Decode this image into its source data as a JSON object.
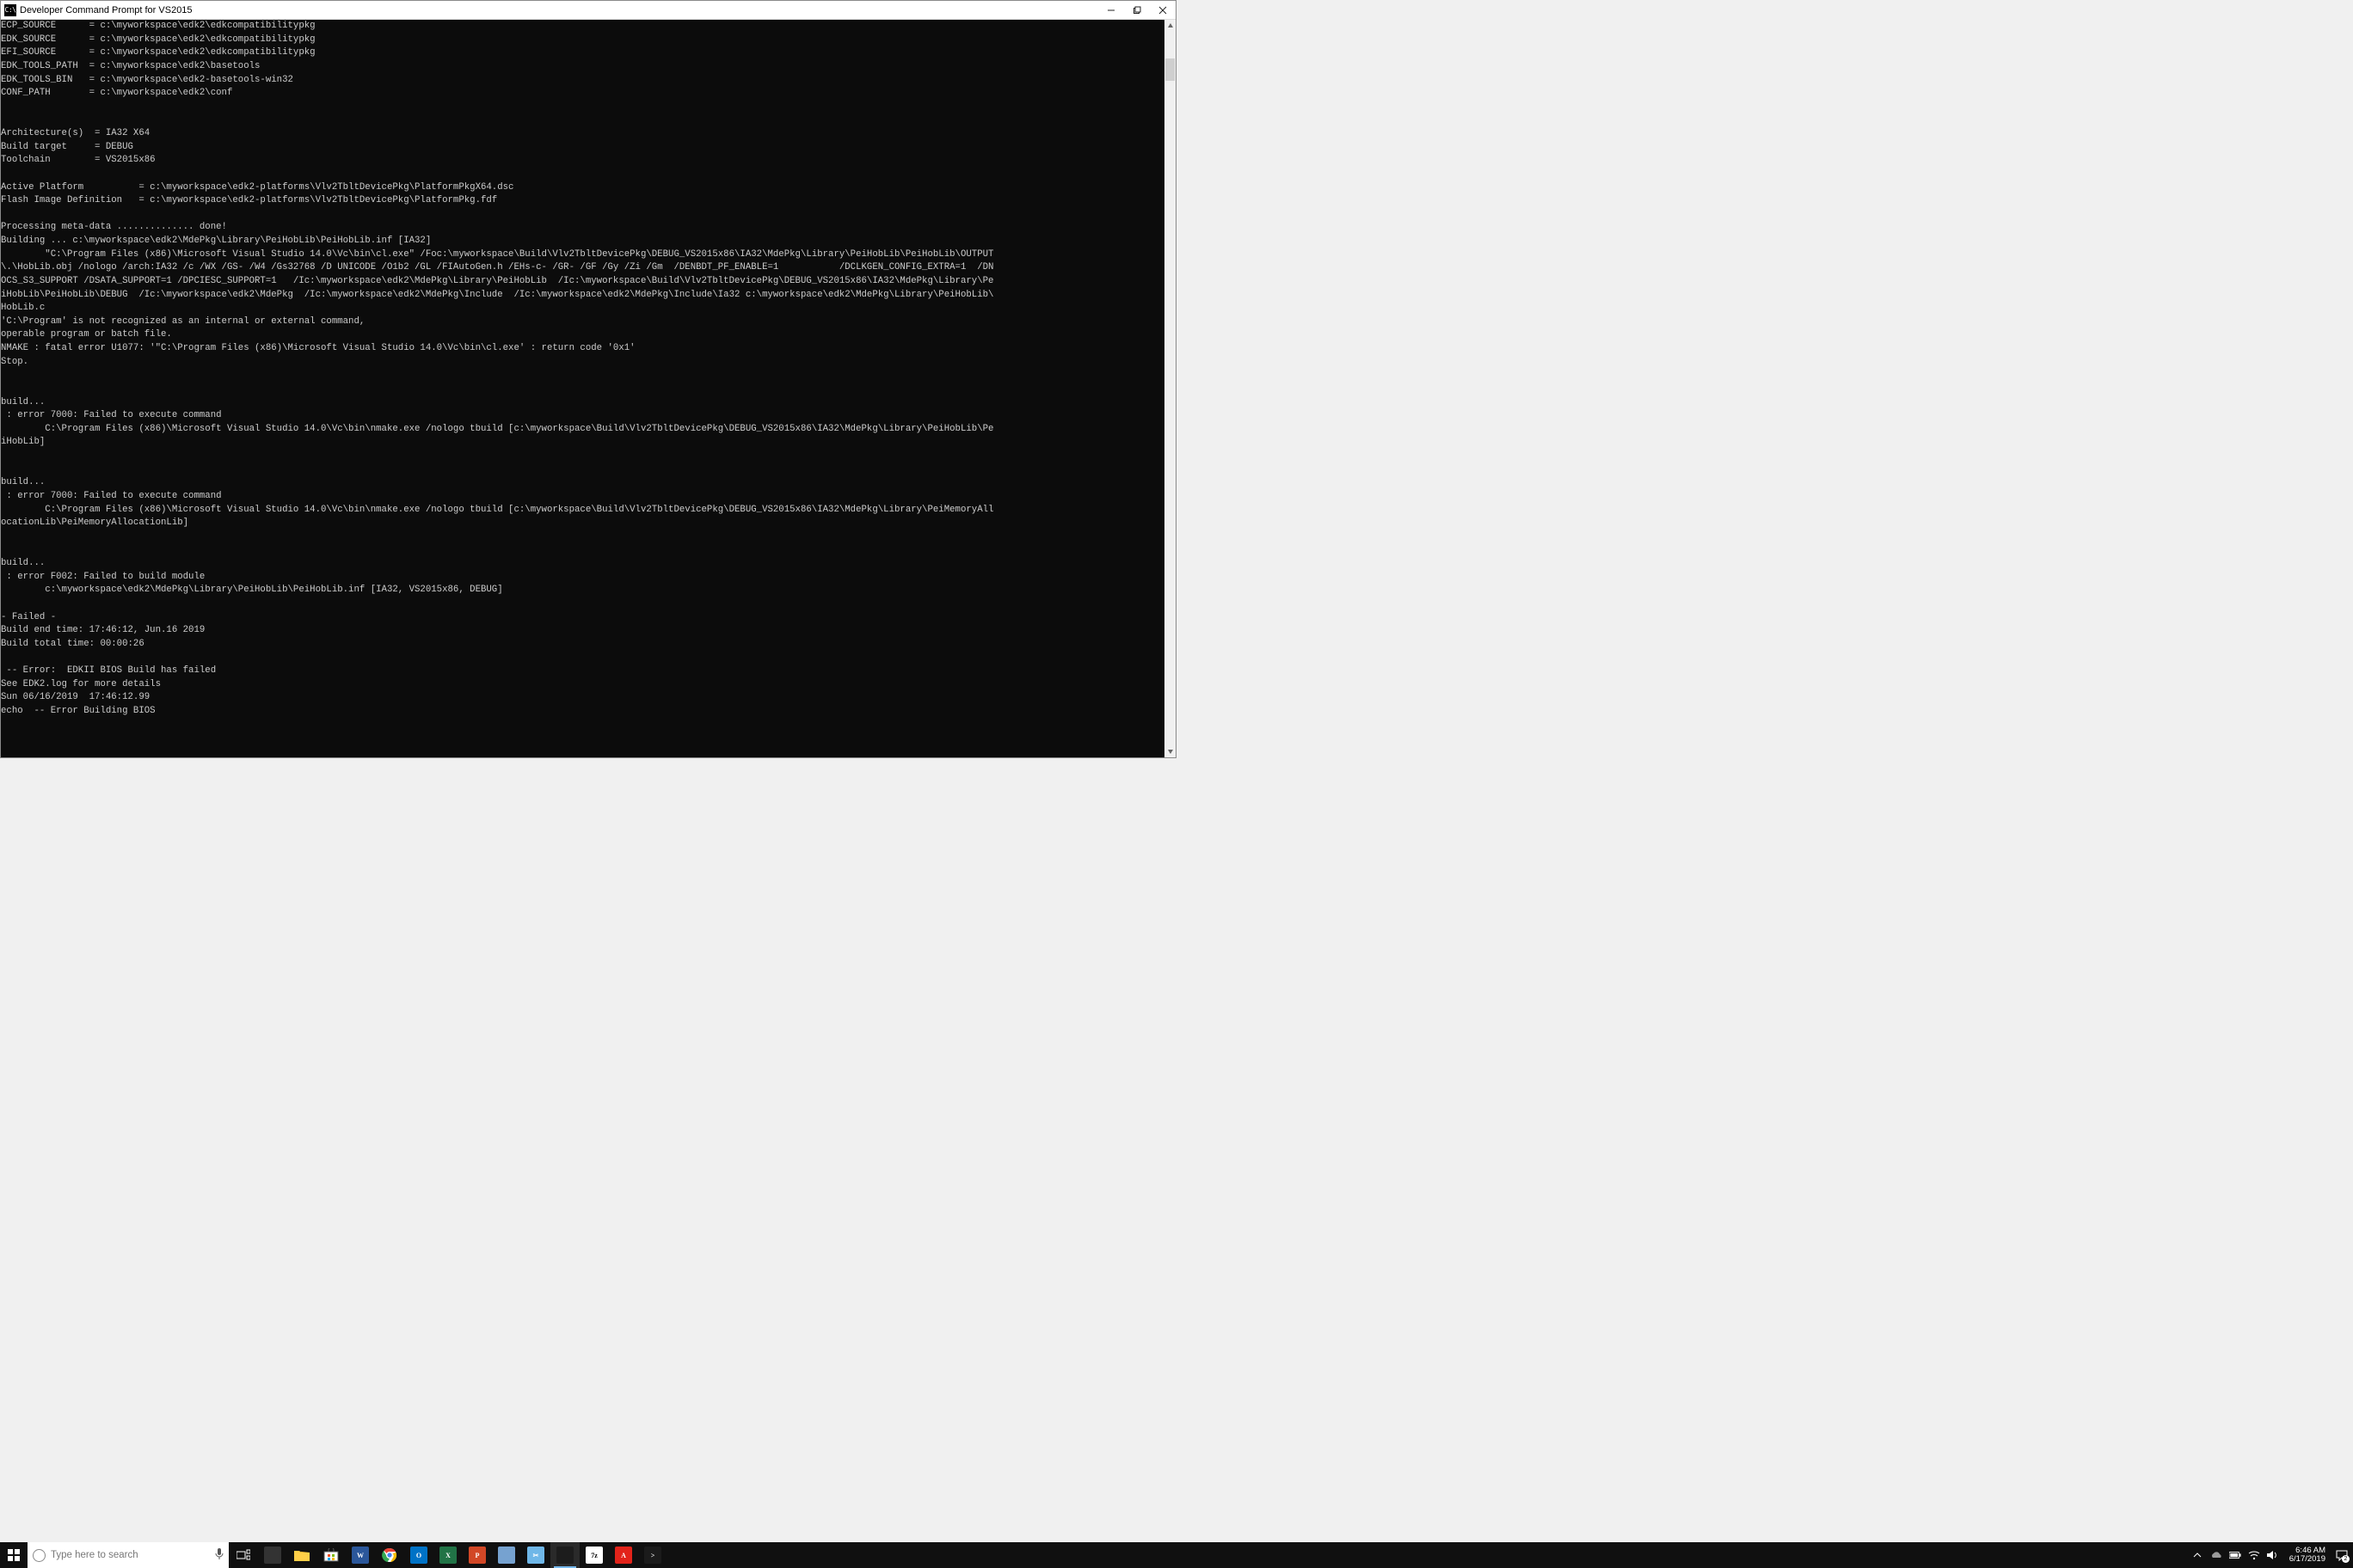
{
  "window": {
    "title": "Developer Command Prompt for VS2015",
    "icon_label": "C:\\"
  },
  "terminal_lines": [
    "ECP_SOURCE      = c:\\myworkspace\\edk2\\edkcompatibilitypkg",
    "EDK_SOURCE      = c:\\myworkspace\\edk2\\edkcompatibilitypkg",
    "EFI_SOURCE      = c:\\myworkspace\\edk2\\edkcompatibilitypkg",
    "EDK_TOOLS_PATH  = c:\\myworkspace\\edk2\\basetools",
    "EDK_TOOLS_BIN   = c:\\myworkspace\\edk2-basetools-win32",
    "CONF_PATH       = c:\\myworkspace\\edk2\\conf",
    "",
    "",
    "Architecture(s)  = IA32 X64",
    "Build target     = DEBUG",
    "Toolchain        = VS2015x86",
    "",
    "Active Platform          = c:\\myworkspace\\edk2-platforms\\Vlv2TbltDevicePkg\\PlatformPkgX64.dsc",
    "Flash Image Definition   = c:\\myworkspace\\edk2-platforms\\Vlv2TbltDevicePkg\\PlatformPkg.fdf",
    "",
    "Processing meta-data .............. done!",
    "Building ... c:\\myworkspace\\edk2\\MdePkg\\Library\\PeiHobLib\\PeiHobLib.inf [IA32]",
    "        \"C:\\Program Files (x86)\\Microsoft Visual Studio 14.0\\Vc\\bin\\cl.exe\" /Foc:\\myworkspace\\Build\\Vlv2TbltDevicePkg\\DEBUG_VS2015x86\\IA32\\MdePkg\\Library\\PeiHobLib\\PeiHobLib\\OUTPUT",
    "\\.\\HobLib.obj /nologo /arch:IA32 /c /WX /GS- /W4 /Gs32768 /D UNICODE /O1b2 /GL /FIAutoGen.h /EHs-c- /GR- /GF /Gy /Zi /Gm  /DENBDT_PF_ENABLE=1           /DCLKGEN_CONFIG_EXTRA=1  /DN",
    "OCS_S3_SUPPORT /DSATA_SUPPORT=1 /DPCIESC_SUPPORT=1   /Ic:\\myworkspace\\edk2\\MdePkg\\Library\\PeiHobLib  /Ic:\\myworkspace\\Build\\Vlv2TbltDevicePkg\\DEBUG_VS2015x86\\IA32\\MdePkg\\Library\\Pe",
    "iHobLib\\PeiHobLib\\DEBUG  /Ic:\\myworkspace\\edk2\\MdePkg  /Ic:\\myworkspace\\edk2\\MdePkg\\Include  /Ic:\\myworkspace\\edk2\\MdePkg\\Include\\Ia32 c:\\myworkspace\\edk2\\MdePkg\\Library\\PeiHobLib\\",
    "HobLib.c",
    "'C:\\Program' is not recognized as an internal or external command,",
    "operable program or batch file.",
    "NMAKE : fatal error U1077: '\"C:\\Program Files (x86)\\Microsoft Visual Studio 14.0\\Vc\\bin\\cl.exe' : return code '0x1'",
    "Stop.",
    "",
    "",
    "build...",
    " : error 7000: Failed to execute command",
    "        C:\\Program Files (x86)\\Microsoft Visual Studio 14.0\\Vc\\bin\\nmake.exe /nologo tbuild [c:\\myworkspace\\Build\\Vlv2TbltDevicePkg\\DEBUG_VS2015x86\\IA32\\MdePkg\\Library\\PeiHobLib\\Pe",
    "iHobLib]",
    "",
    "",
    "build...",
    " : error 7000: Failed to execute command",
    "        C:\\Program Files (x86)\\Microsoft Visual Studio 14.0\\Vc\\bin\\nmake.exe /nologo tbuild [c:\\myworkspace\\Build\\Vlv2TbltDevicePkg\\DEBUG_VS2015x86\\IA32\\MdePkg\\Library\\PeiMemoryAll",
    "ocationLib\\PeiMemoryAllocationLib]",
    "",
    "",
    "build...",
    " : error F002: Failed to build module",
    "        c:\\myworkspace\\edk2\\MdePkg\\Library\\PeiHobLib\\PeiHobLib.inf [IA32, VS2015x86, DEBUG]",
    "",
    "- Failed -",
    "Build end time: 17:46:12, Jun.16 2019",
    "Build total time: 00:00:26",
    "",
    " -- Error:  EDKII BIOS Build has failed",
    "See EDK2.log for more details",
    "Sun 06/16/2019  17:46:12.99",
    "echo  -- Error Building BIOS"
  ],
  "search": {
    "placeholder": "Type here to search"
  },
  "taskbar_apps": [
    {
      "name": "task-view-icon"
    },
    {
      "name": "file-explorer-icon",
      "bg": "#ffcf48",
      "txt": "",
      "glyph": "folder"
    },
    {
      "name": "microsoft-store-icon",
      "bg": "#ffffff",
      "txt": "",
      "glyph": "store"
    },
    {
      "name": "word-icon",
      "bg": "#2b579a",
      "txt": "W"
    },
    {
      "name": "chrome-icon",
      "bg": "#ffffff",
      "txt": "",
      "glyph": "chrome"
    },
    {
      "name": "outlook-icon",
      "bg": "#0072c6",
      "txt": "O"
    },
    {
      "name": "excel-icon",
      "bg": "#217346",
      "txt": "X"
    },
    {
      "name": "powerpoint-icon",
      "bg": "#d24726",
      "txt": "P"
    },
    {
      "name": "app-icon-1",
      "bg": "#76a2d0",
      "txt": ""
    },
    {
      "name": "snip-icon",
      "bg": "#6fb7e8",
      "txt": "✂"
    },
    {
      "name": "cmd-icon",
      "bg": "#1c1c1c",
      "txt": "",
      "active": true
    },
    {
      "name": "7zip-icon",
      "bg": "#ffffff",
      "txt": "7z",
      "fg": "#000"
    },
    {
      "name": "acrobat-icon",
      "bg": "#e2231a",
      "txt": "A"
    },
    {
      "name": "terminal-icon",
      "bg": "#1b1b1b",
      "txt": ">"
    }
  ],
  "tray": {
    "time": "6:46 AM",
    "date": "6/17/2019",
    "notif_count": "2"
  }
}
